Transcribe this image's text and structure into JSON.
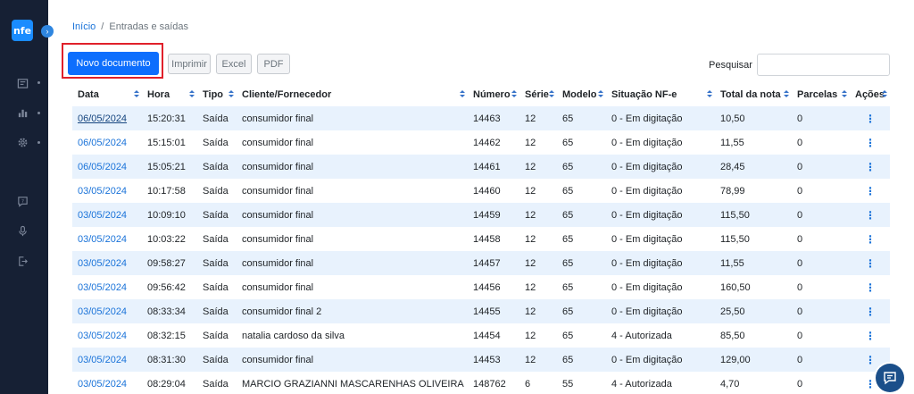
{
  "sidebar": {
    "logo_text": "nfe",
    "icons": [
      "report-icon",
      "chart-icon",
      "gear-icon",
      "help-icon",
      "microphone-icon",
      "logout-icon"
    ]
  },
  "breadcrumb": {
    "home": "Início",
    "separator": "/",
    "current": "Entradas e saídas"
  },
  "toolbar": {
    "new_doc": "Novo documento",
    "print": "Imprimir",
    "excel": "Excel",
    "pdf": "PDF"
  },
  "search": {
    "label": "Pesquisar",
    "value": "",
    "placeholder": ""
  },
  "table": {
    "headers": [
      "Data",
      "Hora",
      "Tipo",
      "Cliente/Fornecedor",
      "Número",
      "Série",
      "Modelo",
      "Situação NF-e",
      "Total da nota",
      "Parcelas",
      "Ações"
    ],
    "rows": [
      [
        "06/05/2024",
        "15:20:31",
        "Saída",
        "consumidor final",
        "14463",
        "12",
        "65",
        "0 - Em digitação",
        "10,50",
        "0"
      ],
      [
        "06/05/2024",
        "15:15:01",
        "Saída",
        "consumidor final",
        "14462",
        "12",
        "65",
        "0 - Em digitação",
        "11,55",
        "0"
      ],
      [
        "06/05/2024",
        "15:05:21",
        "Saída",
        "consumidor final",
        "14461",
        "12",
        "65",
        "0 - Em digitação",
        "28,45",
        "0"
      ],
      [
        "03/05/2024",
        "10:17:58",
        "Saída",
        "consumidor final",
        "14460",
        "12",
        "65",
        "0 - Em digitação",
        "78,99",
        "0"
      ],
      [
        "03/05/2024",
        "10:09:10",
        "Saída",
        "consumidor final",
        "14459",
        "12",
        "65",
        "0 - Em digitação",
        "115,50",
        "0"
      ],
      [
        "03/05/2024",
        "10:03:22",
        "Saída",
        "consumidor final",
        "14458",
        "12",
        "65",
        "0 - Em digitação",
        "115,50",
        "0"
      ],
      [
        "03/05/2024",
        "09:58:27",
        "Saída",
        "consumidor final",
        "14457",
        "12",
        "65",
        "0 - Em digitação",
        "11,55",
        "0"
      ],
      [
        "03/05/2024",
        "09:56:42",
        "Saída",
        "consumidor final",
        "14456",
        "12",
        "65",
        "0 - Em digitação",
        "160,50",
        "0"
      ],
      [
        "03/05/2024",
        "08:33:34",
        "Saída",
        "consumidor final 2",
        "14455",
        "12",
        "65",
        "0 - Em digitação",
        "25,50",
        "0"
      ],
      [
        "03/05/2024",
        "08:32:15",
        "Saída",
        "natalia cardoso da silva",
        "14454",
        "12",
        "65",
        "4 - Autorizada",
        "85,50",
        "0"
      ],
      [
        "03/05/2024",
        "08:31:30",
        "Saída",
        "consumidor final",
        "14453",
        "12",
        "65",
        "0 - Em digitação",
        "129,00",
        "0"
      ],
      [
        "03/05/2024",
        "08:29:04",
        "Saída",
        "MARCIO GRAZIANNI MASCARENHAS OLIVEIRA",
        "148762",
        "6",
        "55",
        "4 - Autorizada",
        "4,70",
        "0"
      ]
    ],
    "action_glyph": "⋮"
  },
  "colors": {
    "sidebar": "#162034",
    "primary": "#0d6efd",
    "link": "#1a73d9",
    "stripe": "#e8f2fd",
    "highlight": "#e0202a"
  }
}
